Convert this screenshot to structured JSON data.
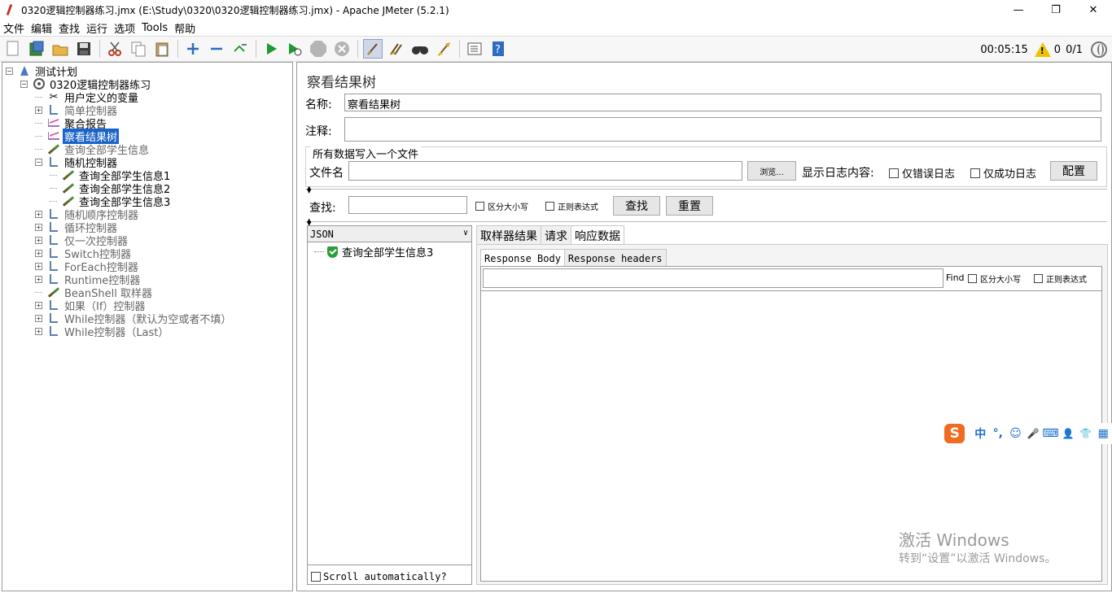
{
  "window": {
    "title": "0320逻辑控制器练习.jmx (E:\\Study\\0320\\0320逻辑控制器练习.jmx) - Apache JMeter (5.2.1)",
    "minimize": "—",
    "maximize": "❐",
    "close": "✕"
  },
  "menu": {
    "file": "文件",
    "edit": "编辑",
    "search": "查找",
    "run": "运行",
    "options": "选项",
    "tools": "Tools",
    "help": "帮助"
  },
  "toolbar": {
    "icons": [
      "new-icon",
      "templates-icon",
      "open-icon",
      "save-icon",
      "cut-icon",
      "copy-icon",
      "paste-icon",
      "expand-icon",
      "collapse-icon",
      "toggle-icon",
      "start-icon",
      "start-no-pause-icon",
      "stop-icon",
      "shutdown-icon",
      "clear-icon",
      "clear-all-icon",
      "search-icon",
      "reset-search-icon",
      "function-helper-icon",
      "help-icon"
    ],
    "elapsed_time": "00:05:15",
    "warning_count": "0",
    "threads": "0/1"
  },
  "tree": {
    "root": "测试计划",
    "plan": "0320逻辑控制器练习",
    "items": [
      {
        "label": "用户定义的变量",
        "expander": "none",
        "icon": "wrench-icon",
        "enabled": true,
        "selected": false
      },
      {
        "label": "简单控制器",
        "expander": "plus",
        "icon": "controller-icon",
        "enabled": false,
        "selected": false
      },
      {
        "label": "聚合报告",
        "expander": "none",
        "icon": "report-icon",
        "enabled": true,
        "selected": false
      },
      {
        "label": "察看结果树",
        "expander": "none",
        "icon": "report-icon",
        "enabled": true,
        "selected": true
      },
      {
        "label": "查询全部学生信息",
        "expander": "none",
        "icon": "sampler-icon",
        "enabled": false,
        "selected": false
      },
      {
        "label": "随机控制器",
        "expander": "minus",
        "icon": "controller-icon",
        "enabled": true,
        "selected": false
      },
      {
        "label": "查询全部学生信息1",
        "expander": "none",
        "icon": "sampler-icon",
        "enabled": true,
        "selected": false,
        "child": true
      },
      {
        "label": "查询全部学生信息2",
        "expander": "none",
        "icon": "sampler-icon",
        "enabled": true,
        "selected": false,
        "child": true
      },
      {
        "label": "查询全部学生信息3",
        "expander": "none",
        "icon": "sampler-icon",
        "enabled": true,
        "selected": false,
        "child": true
      },
      {
        "label": "随机顺序控制器",
        "expander": "plus",
        "icon": "controller-icon",
        "enabled": false,
        "selected": false
      },
      {
        "label": "循环控制器",
        "expander": "plus",
        "icon": "controller-icon",
        "enabled": false,
        "selected": false
      },
      {
        "label": "仅一次控制器",
        "expander": "plus",
        "icon": "controller-icon",
        "enabled": false,
        "selected": false
      },
      {
        "label": "Switch控制器",
        "expander": "plus",
        "icon": "controller-icon",
        "enabled": false,
        "selected": false
      },
      {
        "label": "ForEach控制器",
        "expander": "plus",
        "icon": "controller-icon",
        "enabled": false,
        "selected": false
      },
      {
        "label": "Runtime控制器",
        "expander": "plus",
        "icon": "controller-icon",
        "enabled": false,
        "selected": false
      },
      {
        "label": "BeanShell 取样器",
        "expander": "none",
        "icon": "sampler-icon",
        "enabled": false,
        "selected": false
      },
      {
        "label": "如果（If）控制器",
        "expander": "plus",
        "icon": "controller-icon",
        "enabled": false,
        "selected": false
      },
      {
        "label": "While控制器（默认为空或者不填）",
        "expander": "plus",
        "icon": "controller-icon",
        "enabled": false,
        "selected": false
      },
      {
        "label": "While控制器（Last）",
        "expander": "plus",
        "icon": "controller-icon",
        "enabled": false,
        "selected": false
      }
    ]
  },
  "panel": {
    "title": "察看结果树",
    "name_label": "名称:",
    "name_value": "察看结果树",
    "comment_label": "注释:",
    "comment_value": "",
    "file_group_title": "所有数据写入一个文件",
    "filename_label": "文件名",
    "filename_value": "",
    "browse_button": "浏览...",
    "log_label": "显示日志内容:",
    "errors_only": "仅错误日志",
    "success_only": "仅成功日志",
    "configure_button": "配置",
    "search_label": "查找:",
    "search_value": "",
    "case_sensitive": "区分大小写",
    "regex": "正则表达式",
    "search_button": "查找",
    "reset_button": "重置"
  },
  "results": {
    "renderer": "JSON",
    "items": [
      "查询全部学生信息3"
    ],
    "scroll_auto": "Scroll automatically?",
    "tabs": [
      "取样器结果",
      "请求",
      "响应数据"
    ],
    "active_tab": "响应数据",
    "subtabs": [
      "Response Body",
      "Response headers"
    ],
    "active_subtab": "Response Body",
    "find_label": "Find",
    "find_case": "区分大小写",
    "find_regex": "正则表达式"
  },
  "ime": {
    "logo": "S",
    "items": [
      "中",
      "°,",
      "☺",
      "🎤",
      "⌨",
      "👤",
      "👕",
      "▦"
    ]
  },
  "watermark": {
    "line1": "激活 Windows",
    "line2": "转到“设置”以激活 Windows。"
  }
}
